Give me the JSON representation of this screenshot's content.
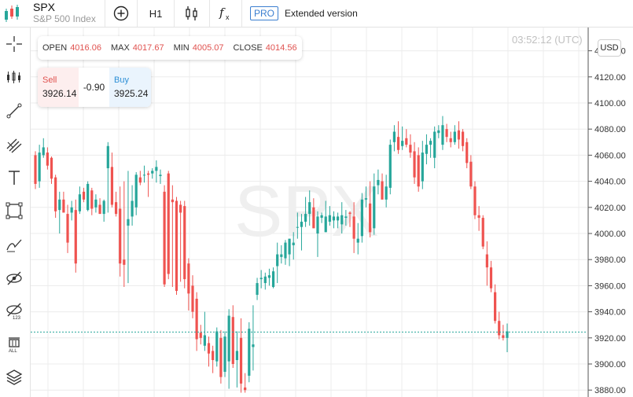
{
  "symbol": {
    "ticker": "SPX",
    "name": "S&P 500 Index"
  },
  "toolbar": {
    "timeframe": "H1",
    "pro_badge": "PRO",
    "pro_label": "Extended version"
  },
  "ohlc": {
    "open_label": "OPEN",
    "open": "4016.06",
    "max_label": "MAX",
    "max": "4017.67",
    "min_label": "MIN",
    "min": "4005.07",
    "close_label": "CLOSE",
    "close": "4014.56"
  },
  "trade": {
    "sell_label": "Sell",
    "sell_price": "3926.14",
    "spread": "-0.90",
    "buy_label": "Buy",
    "buy_price": "3925.24"
  },
  "clock": "03:52:12 (UTC)",
  "currency_button": "USD",
  "watermark": "SPX",
  "colors": {
    "up": "#26a69a",
    "down": "#ef5350",
    "sell": "#e0524f",
    "buy": "#2d8fd6",
    "current_line": "#26a69a"
  },
  "left_tools": [
    "crosshair-icon",
    "indicators-icon",
    "trendline-icon",
    "fib-icon",
    "text-icon",
    "rectangle-icon",
    "brush-icon",
    "hide-drawings-icon",
    "hide-indicators-icon",
    "delete-all-icon",
    "layers-icon"
  ],
  "chart_data": {
    "type": "candlestick",
    "y_ticks": [
      "3880.00",
      "3900.00",
      "3920.00",
      "3940.00",
      "3960.00",
      "3980.00",
      "4000.00",
      "4020.00",
      "4040.00",
      "4060.00",
      "4080.00",
      "4100.00",
      "4120.00",
      "4140.00"
    ],
    "ylim": [
      3875,
      4150
    ],
    "current_price": 3924.5,
    "ohlc": [
      [
        4060.0,
        4063.0,
        4034.0,
        4038.0
      ],
      [
        4040.0,
        4068.0,
        4035.0,
        4062.0
      ],
      [
        4060.0,
        4073.0,
        4058.0,
        4066.0
      ],
      [
        4062.0,
        4066.0,
        4049.0,
        4052.0
      ],
      [
        4058.0,
        4059.0,
        4038.0,
        4042.0
      ],
      [
        4043.0,
        4045.0,
        4012.0,
        4017.0
      ],
      [
        4018.0,
        4032.0,
        4000.0,
        4026.0
      ],
      [
        4026.0,
        4032.0,
        4016.0,
        4016.0
      ],
      [
        4015.0,
        4022.0,
        3985.0,
        3993.0
      ],
      [
        4016.0,
        4025.0,
        4010.0,
        4020.0
      ],
      [
        4018.0,
        4026.0,
        3970.0,
        3977.0
      ],
      [
        4017.0,
        4036.0,
        4015.0,
        4030.0
      ],
      [
        4032.0,
        4035.0,
        4024.0,
        4026.0
      ],
      [
        4018.0,
        4040.0,
        4017.0,
        4038.0
      ],
      [
        4033.0,
        4035.0,
        4014.0,
        4019.0
      ],
      [
        4020.0,
        4030.0,
        4016.0,
        4026.0
      ],
      [
        4022.0,
        4027.0,
        4015.0,
        4015.0
      ],
      [
        4015.0,
        4026.0,
        4009.0,
        4025.0
      ],
      [
        4050.0,
        4070.0,
        4016.0,
        4067.0
      ],
      [
        4051.0,
        4062.0,
        4020.0,
        4022.0
      ],
      [
        4024.0,
        4032.0,
        4013.0,
        4015.0
      ],
      [
        4019.0,
        4036.0,
        3967.0,
        3977.0
      ],
      [
        3980.0,
        4040.0,
        3959.0,
        3976.0
      ],
      [
        4006.0,
        4048.0,
        3962.0,
        4011.0
      ],
      [
        4013.0,
        4037.0,
        4006.0,
        4025.0
      ],
      [
        4020.0,
        4047.0,
        4014.0,
        4045.0
      ],
      [
        4043.0,
        4048.0,
        4037.0,
        4039.0
      ],
      [
        4045.0,
        4052.0,
        4039.0,
        4045.0
      ],
      [
        4046.0,
        4048.0,
        4028.0,
        4045.0
      ],
      [
        4046.0,
        4050.0,
        4042.0,
        4048.0
      ],
      [
        4048.0,
        4056.0,
        4039.0,
        4051.0
      ],
      [
        4044.0,
        4049.0,
        4038.0,
        4045.0
      ],
      [
        4032.0,
        4037.0,
        3959.0,
        3961.0
      ],
      [
        4046.0,
        4048.0,
        3965.0,
        3969.0
      ],
      [
        4026.0,
        4037.0,
        3959.0,
        4024.0
      ],
      [
        4025.0,
        4028.0,
        3953.0,
        3956.0
      ],
      [
        4022.0,
        4025.0,
        3963.0,
        4016.0
      ],
      [
        4021.0,
        4025.0,
        3958.0,
        3965.0
      ],
      [
        3977.0,
        3981.0,
        3941.0,
        3954.0
      ],
      [
        3960.0,
        3968.0,
        3935.0,
        3940.0
      ],
      [
        3950.0,
        3955.0,
        3910.0,
        3919.0
      ],
      [
        3924.0,
        3930.0,
        3915.0,
        3920.0
      ],
      [
        3914.0,
        3940.0,
        3910.0,
        3922.0
      ],
      [
        3916.0,
        3921.0,
        3898.0,
        3908.0
      ],
      [
        3910.0,
        3914.0,
        3893.0,
        3903.0
      ],
      [
        3902.0,
        3928.0,
        3898.0,
        3925.0
      ],
      [
        3920.0,
        3926.0,
        3885.0,
        3890.0
      ],
      [
        3894.0,
        3925.0,
        3890.0,
        3921.0
      ],
      [
        3902.0,
        3942.0,
        3881.0,
        3937.0
      ],
      [
        3936.0,
        3945.0,
        3897.0,
        3900.0
      ],
      [
        3903.0,
        3925.0,
        3882.0,
        3910.0
      ],
      [
        3920.0,
        3935.0,
        3878.0,
        3885.0
      ],
      [
        3882.0,
        3893.0,
        3878.0,
        3880.0
      ],
      [
        3891.0,
        3932.0,
        3886.0,
        3927.0
      ],
      [
        3913.0,
        3945.0,
        3895.0,
        3915.0
      ],
      [
        3953.0,
        3966.0,
        3949.0,
        3962.0
      ],
      [
        3965.0,
        3972.0,
        3958.0,
        3966.0
      ],
      [
        3962.0,
        3970.0,
        3957.0,
        3967.0
      ],
      [
        3966.0,
        3973.0,
        3960.0,
        3968.0
      ],
      [
        3959.0,
        3974.0,
        3958.0,
        3971.0
      ],
      [
        3975.0,
        3993.0,
        3962.0,
        3984.0
      ],
      [
        3982.0,
        3991.0,
        3977.0,
        3984.0
      ],
      [
        3981.0,
        3995.0,
        3976.0,
        3993.0
      ],
      [
        3984.0,
        3996.0,
        3975.0,
        3996.0
      ],
      [
        3991.0,
        4001.0,
        3980.0,
        3993.0
      ],
      [
        4005.0,
        4016.0,
        3996.0,
        4005.0
      ],
      [
        4005.0,
        4015.0,
        3987.0,
        4009.0
      ],
      [
        4009.0,
        4028.0,
        4005.0,
        4015.0
      ],
      [
        4015.0,
        4033.0,
        4006.0,
        4024.0
      ],
      [
        4020.0,
        4027.0,
        4004.0,
        4004.0
      ],
      [
        4000.0,
        4017.0,
        3982.0,
        4013.0
      ],
      [
        4012.0,
        4016.0,
        4008.0,
        4014.0
      ],
      [
        4001.0,
        4025.0,
        4001.0,
        4013.0
      ],
      [
        4009.0,
        4021.0,
        4006.0,
        4014.0
      ],
      [
        4010.0,
        4017.0,
        4004.0,
        4013.0
      ],
      [
        4010.0,
        4016.0,
        4004.0,
        4013.0
      ],
      [
        4007.0,
        4024.0,
        4000.0,
        4014.0
      ],
      [
        4012.0,
        4018.0,
        4006.0,
        4013.0
      ],
      [
        4016.0,
        4017.0,
        4005.0,
        4015.0
      ],
      [
        4013.0,
        4024.0,
        3985.0,
        3996.0
      ],
      [
        3993.0,
        4008.0,
        3984.0,
        3996.0
      ],
      [
        3998.0,
        4031.0,
        3993.0,
        4026.0
      ],
      [
        4026.0,
        4036.0,
        4020.0,
        4027.0
      ],
      [
        4023.0,
        4040.0,
        3997.0,
        4001.0
      ],
      [
        4004.0,
        4046.0,
        3999.0,
        4036.0
      ],
      [
        4037.0,
        4049.0,
        4030.0,
        4041.0
      ],
      [
        4040.0,
        4046.0,
        4026.0,
        4026.0
      ],
      [
        4026.0,
        4045.0,
        4020.0,
        4036.0
      ],
      [
        4035.0,
        4072.0,
        4030.0,
        4068.0
      ],
      [
        4070.0,
        4083.0,
        4063.0,
        4078.0
      ],
      [
        4074.0,
        4086.0,
        4061.0,
        4064.0
      ],
      [
        4067.0,
        4082.0,
        4064.0,
        4071.0
      ],
      [
        4073.0,
        4080.0,
        4066.0,
        4068.0
      ],
      [
        4068.0,
        4076.0,
        4058.0,
        4062.0
      ],
      [
        4063.0,
        4070.0,
        4038.0,
        4043.0
      ],
      [
        4060.0,
        4066.0,
        4032.0,
        4036.0
      ],
      [
        4040.0,
        4071.0,
        4034.0,
        4062.0
      ],
      [
        4061.0,
        4076.0,
        4053.0,
        4068.0
      ],
      [
        4068.0,
        4073.0,
        4058.0,
        4071.0
      ],
      [
        4058.0,
        4082.0,
        4050.0,
        4078.0
      ],
      [
        4077.0,
        4083.0,
        4073.0,
        4079.0
      ],
      [
        4068.0,
        4090.0,
        4064.0,
        4083.0
      ],
      [
        4080.0,
        4084.0,
        4070.0,
        4074.0
      ],
      [
        4073.0,
        4078.0,
        4066.0,
        4070.0
      ],
      [
        4070.0,
        4083.0,
        4068.0,
        4078.0
      ],
      [
        4079.0,
        4086.0,
        4065.0,
        4072.0
      ],
      [
        4078.0,
        4080.0,
        4063.0,
        4067.0
      ],
      [
        4070.0,
        4073.0,
        4050.0,
        4054.0
      ],
      [
        4055.0,
        4060.0,
        4034.0,
        4036.0
      ],
      [
        4036.0,
        4040.0,
        4011.0,
        4014.0
      ],
      [
        4014.0,
        4021.0,
        4002.0,
        4012.0
      ],
      [
        4012.0,
        4014.0,
        3988.0,
        3990.0
      ],
      [
        3984.0,
        3994.0,
        3960.0,
        3974.0
      ],
      [
        3974.0,
        3979.0,
        3955.0,
        3958.0
      ],
      [
        3955.0,
        3961.0,
        3931.0,
        3933.0
      ],
      [
        3933.0,
        3940.0,
        3919.0,
        3922.0
      ],
      [
        3922.0,
        3930.0,
        3918.0,
        3920.0
      ],
      [
        3920.0,
        3931.0,
        3909.0,
        3925.0
      ]
    ]
  }
}
